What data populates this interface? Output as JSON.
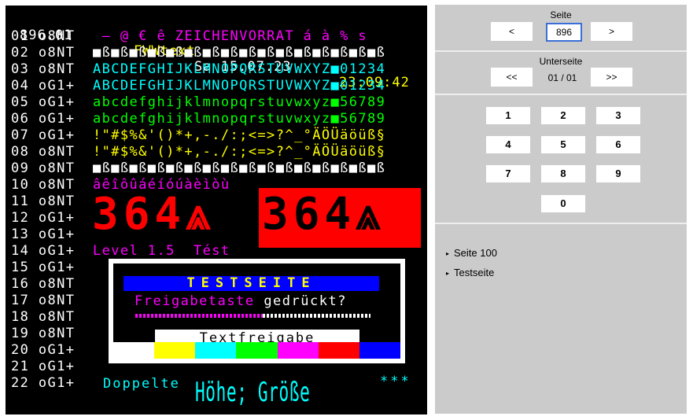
{
  "teletext": {
    "header": {
      "page": "896.01",
      "service": "FWWtext",
      "date": "Sa 15.07.23",
      "time": "23:09:42"
    },
    "rows": [
      {
        "num": "01 o8NT",
        "text": " – @ € ê ZEICHENVORRAT á à % s",
        "color": "#ff00ff"
      },
      {
        "num": "02 o8NT",
        "text": "■ß■ß■ß■ß■ß■ß■ß■ß■ß■ß■ß■ß■ß■ß■ß■ß",
        "color": "#ffffff"
      },
      {
        "num": "03 o8NT",
        "text": "ABCDEFGHIJKLMNOPQRSTUVWXYZ■01234",
        "color": "#00ffff"
      },
      {
        "num": "04 oG1+",
        "text": "ABCDEFGHIJKLMNOPQRSTUVWXYZ■01234",
        "color": "#00ffff"
      },
      {
        "num": "05 oG1+",
        "text": "abcdefghijklmnopqrstuvwxyz■56789",
        "color": "#00ff00"
      },
      {
        "num": "06 oG1+",
        "text": "abcdefghijklmnopqrstuvwxyz■56789",
        "color": "#00ff00"
      },
      {
        "num": "07 oG1+",
        "text": "!\"#$%&'()*+,-./:;<=>?^_°ÄÖÜäöüß§",
        "color": "#ffff00"
      },
      {
        "num": "08 o8NT",
        "text": "!\"#$%&'()*+,-./:;<=>?^_°ÄÖÜäöüß§",
        "color": "#ffff00"
      },
      {
        "num": "09 o8NT",
        "text": "■ß■ß■ß■ß■ß■ß■ß■ß■ß■ß■ß■ß■ß■ß■ß■ß",
        "color": "#ffffff"
      },
      {
        "num": "10 o8NT",
        "text": "âêîôûáéíóúàèìòù",
        "color": "#ff00ff"
      },
      {
        "num": "11 o8NT",
        "text": "",
        "color": "#ff0000"
      },
      {
        "num": "12 oG1+",
        "text": "",
        "color": "#ff0000"
      },
      {
        "num": "13 oG1+",
        "text": "",
        "color": "#ff0000"
      },
      {
        "num": "14 oG1+",
        "text": "Level 1.5  Tést",
        "color": "#ff00ff"
      },
      {
        "num": "15 oG1+",
        "text": "",
        "color": "#ffffff"
      },
      {
        "num": "16 o8NT",
        "text": "",
        "color": "#ffffff"
      },
      {
        "num": "17 o8NT",
        "text": "",
        "color": "#ffffff"
      },
      {
        "num": "18 o8NT",
        "text": "",
        "color": "#ffffff"
      },
      {
        "num": "19 o8NT",
        "text": "",
        "color": "#ffffff"
      },
      {
        "num": "20 oG1+",
        "text": "",
        "color": "#ffffff"
      },
      {
        "num": "21 oG1+",
        "text": "",
        "color": "#ffffff"
      },
      {
        "num": "22 oG1+",
        "text": "",
        "color": "#ffffff"
      }
    ],
    "big_text_1": "364⩓",
    "big_text_2": "364⩓",
    "testcard": {
      "title": "TESTSEITE",
      "prompt_part1": "Freigabetaste",
      "prompt_part2": "gedrückt?",
      "release_label": "Textfreigabe",
      "bars": [
        "#ffffff",
        "#ffff00",
        "#00ffff",
        "#00ff00",
        "#ff00ff",
        "#ff0000",
        "#0000ff"
      ]
    },
    "bottom_left": "Doppelte",
    "bottom_big": "Höhe; Größe",
    "bottom_stars": "***"
  },
  "panel": {
    "page_label": "Seite",
    "prev_label": "<",
    "next_label": ">",
    "page_value": "896",
    "subpage_label": "Unterseite",
    "sub_prev_label": "<<",
    "sub_next_label": ">>",
    "subpage_value": "01 / 01",
    "keypad": [
      "1",
      "2",
      "3",
      "4",
      "5",
      "6",
      "7",
      "8",
      "9",
      "0"
    ],
    "links": [
      "Seite 100",
      "Testseite"
    ]
  },
  "colors": {
    "panel_bg": "#cbcbcb",
    "teletext_bg": "#000000",
    "input_border": "#3a6fd8"
  }
}
